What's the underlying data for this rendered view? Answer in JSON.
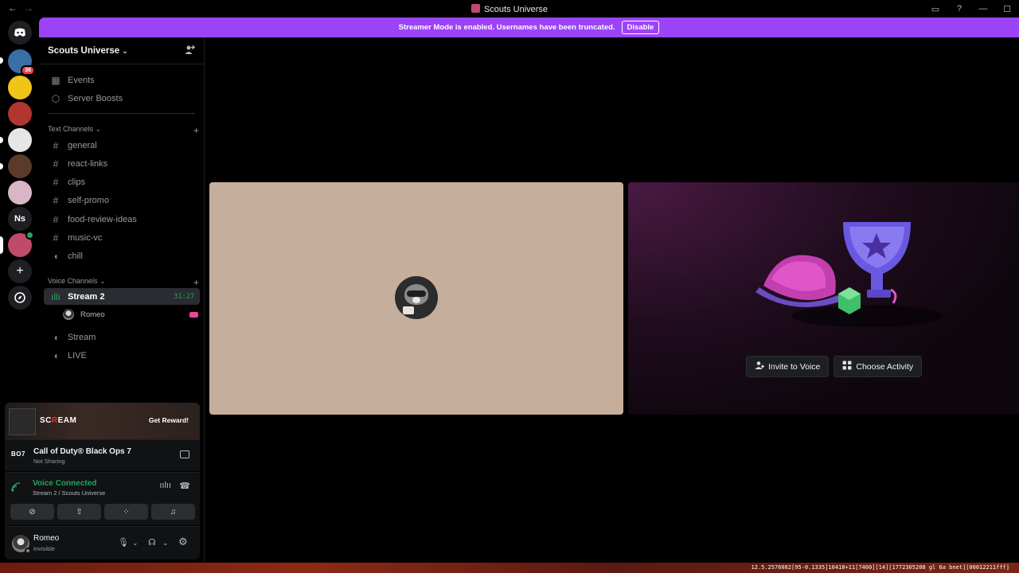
{
  "window": {
    "title": "Scouts Universe",
    "back": "←",
    "forward": "→"
  },
  "banner": {
    "text": "Streamer Mode is enabled. Usernames have been truncated.",
    "button": "Disable",
    "color": "#9b44f7"
  },
  "rail": {
    "home_icon": "discord-icon",
    "servers": [
      {
        "label": "",
        "color": "#3a6ea5",
        "badge": "36"
      },
      {
        "label": "",
        "color": "#f0c419",
        "badge": ""
      },
      {
        "label": "",
        "color": "#b1362f",
        "badge": ""
      },
      {
        "label": "",
        "color": "#e6e6e6",
        "badge": ""
      },
      {
        "label": "",
        "color": "#5a3b2a",
        "badge": ""
      },
      {
        "label": "",
        "color": "#d8b6c8",
        "badge": ""
      },
      {
        "label": "Ns",
        "color": "#1e1f22",
        "badge": ""
      },
      {
        "label": "",
        "color": "#c04a6c",
        "badge": ""
      }
    ],
    "add_server": "+",
    "discover": "compass-icon"
  },
  "sidebar": {
    "server_name": "Scouts Universe",
    "items": [
      {
        "label": "Events",
        "icon": "calendar-icon"
      },
      {
        "label": "Server Boosts",
        "icon": "boost-icon"
      }
    ],
    "text_category": "Text Channels",
    "text_channels": [
      "general",
      "react-links",
      "clips",
      "self-promo",
      "food-review-ideas",
      "music-vc"
    ],
    "chill_channel": "chill",
    "voice_category": "Voice Channels",
    "voice_channels": [
      {
        "label": "Stream 2",
        "active": true,
        "timer": "31:27"
      },
      {
        "label": "Stream",
        "active": false,
        "timer": ""
      },
      {
        "label": "LIVE",
        "active": false,
        "timer": ""
      }
    ],
    "voice_user": "Romeo"
  },
  "promo": {
    "brand_a": "SC",
    "brand_b": "R",
    "brand_c": "EAM",
    "reward": "Get Reward!"
  },
  "game": {
    "logo": "BO7",
    "name": "Call of Duty® Black Ops 7",
    "status": "Not Sharing"
  },
  "voice": {
    "status": "Voice Connected",
    "location": "Stream 2 / Scouts Universe"
  },
  "user": {
    "name": "Romeo",
    "status": "Invisible"
  },
  "activity": {
    "invite_label": "Invite to Voice",
    "choose_label": "Choose Activity"
  },
  "taskbar": {
    "status_text": "12.5.2576082[95-0.1335]10418+11[7400][14][1772305208 gl 6a bnet][00012211fff]"
  }
}
